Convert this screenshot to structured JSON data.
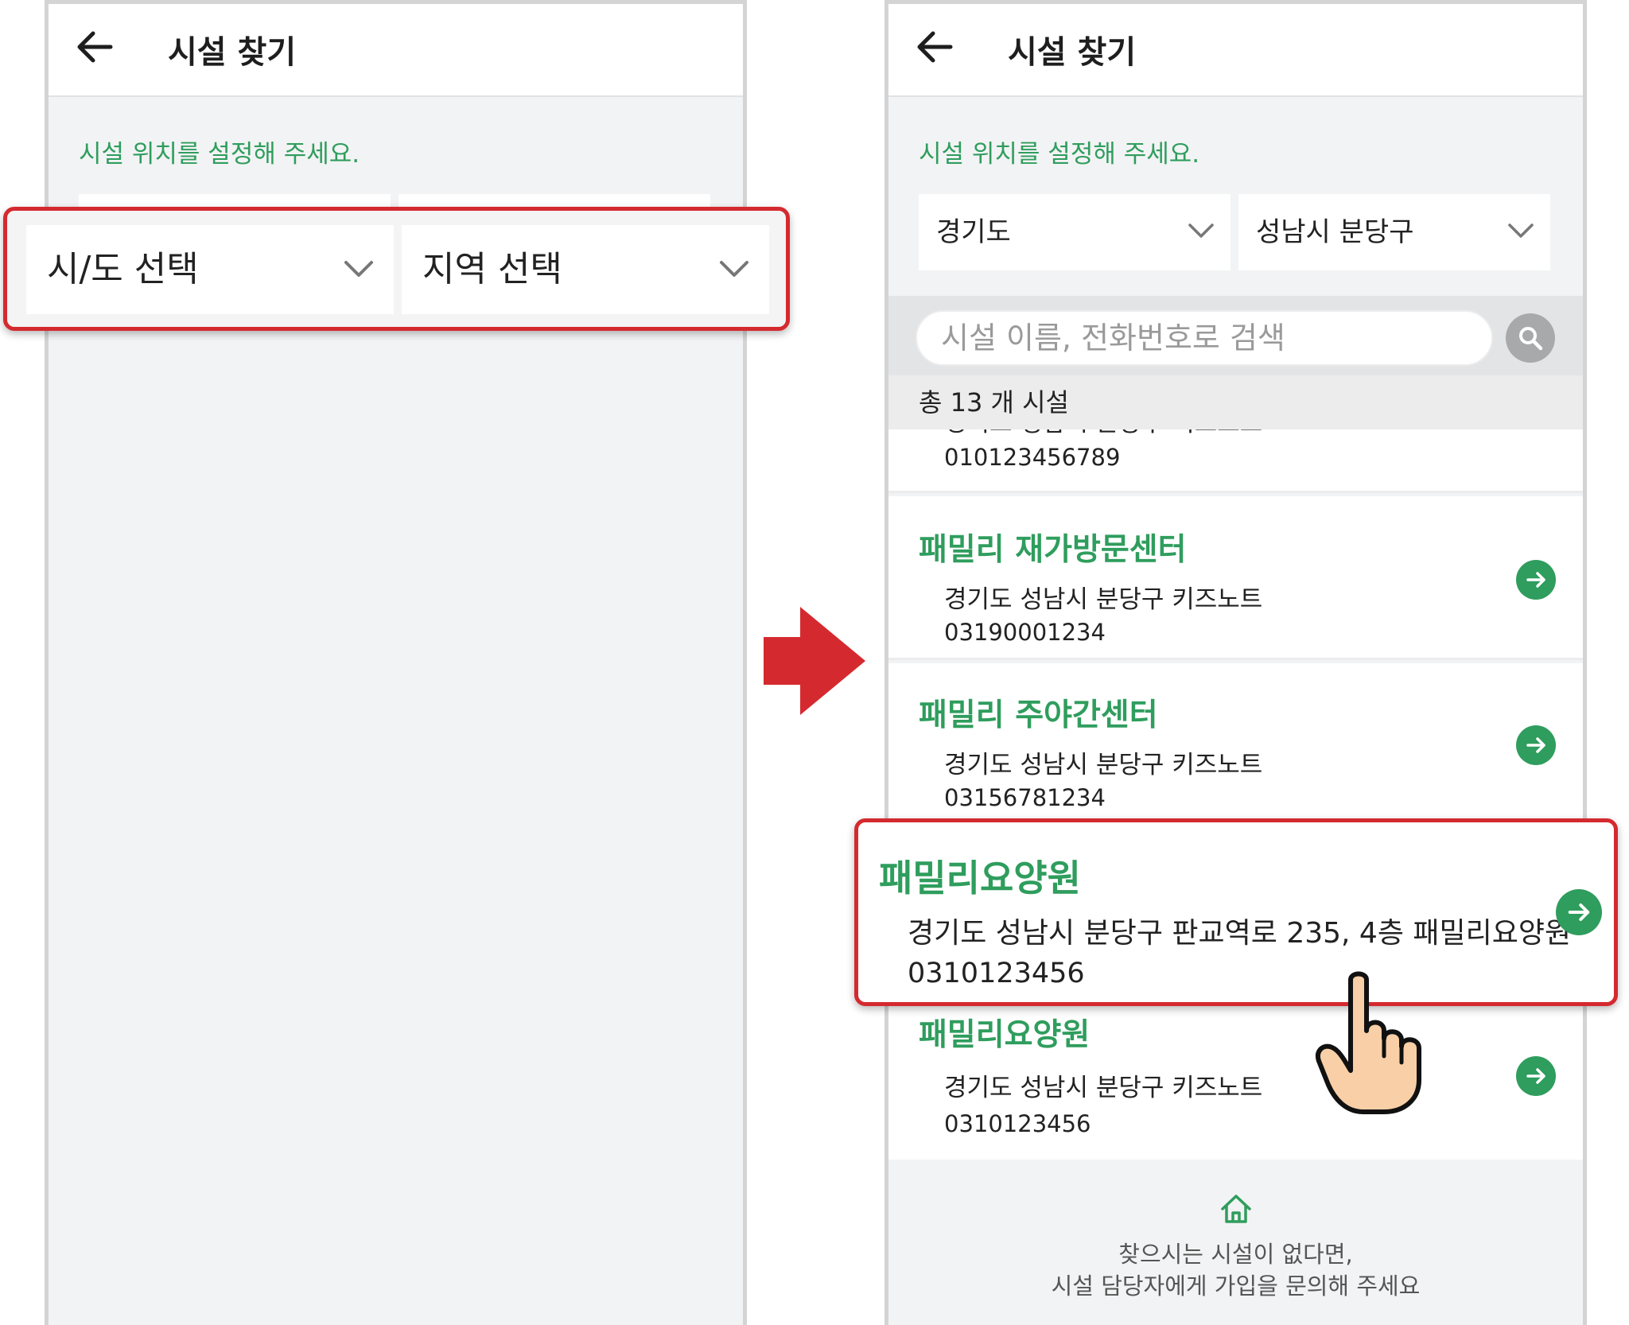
{
  "left_screen": {
    "title": "시설 찾기",
    "hint": "시설 위치를 설정해 주세요.",
    "province_select": "시/도 선택",
    "region_select": "지역 선택"
  },
  "right_screen": {
    "title": "시설 찾기",
    "hint": "시설 위치를 설정해 주세요.",
    "province_select": "경기도",
    "region_select": "성남시 분당구",
    "search_placeholder": "시설 이름, 전화번호로 검색",
    "count_text": "총 13 개 시설",
    "partial_item": {
      "address": "경기도 성남시 분당구 키즈노트",
      "phone": "010123456789"
    },
    "items": [
      {
        "name": "패밀리 재가방문센터",
        "address": "경기도 성남시 분당구 키즈노트",
        "phone": "03190001234"
      },
      {
        "name": "패밀리 주야간센터",
        "address": "경기도 성남시 분당구 키즈노트",
        "phone": "03156781234"
      },
      {
        "name": "패밀리요양원",
        "address": "경기도 성남시 분당구 판교역로 235, 4층 패밀리요양원",
        "phone": "0310123456"
      },
      {
        "name": "패밀리요양원",
        "address": "경기도 성남시 분당구 키즈노트",
        "phone": "0310123456"
      }
    ],
    "footer_line1": "찾으시는 시설이 없다면,",
    "footer_line2": "시설 담당자에게 가입을 문의해 주세요"
  },
  "colors": {
    "accent_green": "#2f9d5d",
    "highlight_red": "#d42a2f",
    "background_gray": "#f2f3f4"
  },
  "icons": [
    "back-arrow-icon",
    "chevron-down-icon",
    "search-icon",
    "arrow-right-circle-icon",
    "home-icon",
    "pointing-hand-icon",
    "right-arrow-icon"
  ]
}
